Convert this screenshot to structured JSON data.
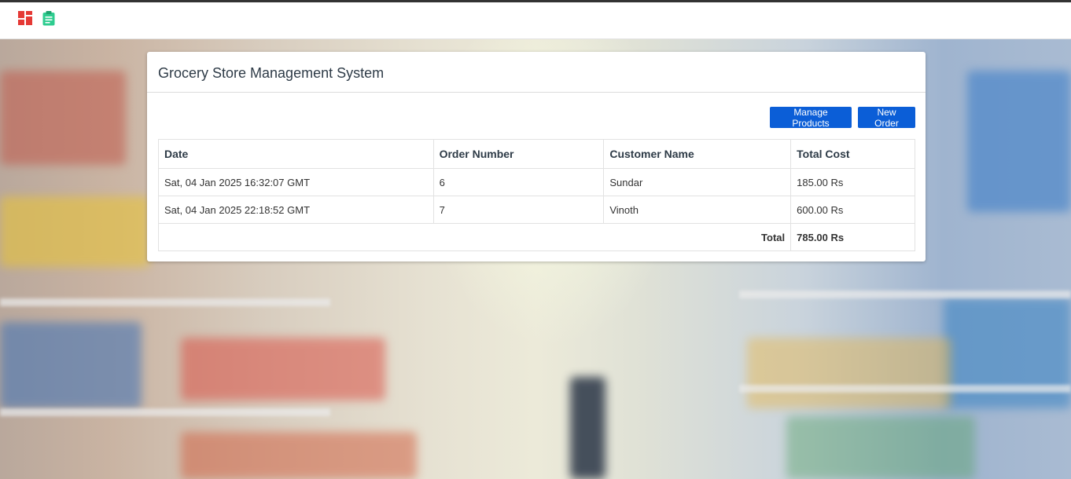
{
  "navbar": {
    "icons": [
      "dashboard-icon",
      "clipboard-icon"
    ],
    "colors": {
      "dashboard": "#e53935",
      "clipboard": "#2ecc8f"
    }
  },
  "card": {
    "title": "Grocery Store Management System"
  },
  "toolbar": {
    "manage_products_label": "Manage Products",
    "new_order_label": "New Order"
  },
  "orders_table": {
    "headers": [
      "Date",
      "Order Number",
      "Customer Name",
      "Total Cost"
    ],
    "rows": [
      {
        "date": "Sat, 04 Jan 2025 16:32:07 GMT",
        "order_number": "6",
        "customer_name": "Sundar",
        "total_cost": "185.00 Rs"
      },
      {
        "date": "Sat, 04 Jan 2025 22:18:52 GMT",
        "order_number": "7",
        "customer_name": "Vinoth",
        "total_cost": "600.00 Rs"
      }
    ],
    "total_label": "Total",
    "total_value": "785.00 Rs"
  },
  "colors": {
    "accent": "#0b5ed7",
    "top_border": "#333333"
  }
}
